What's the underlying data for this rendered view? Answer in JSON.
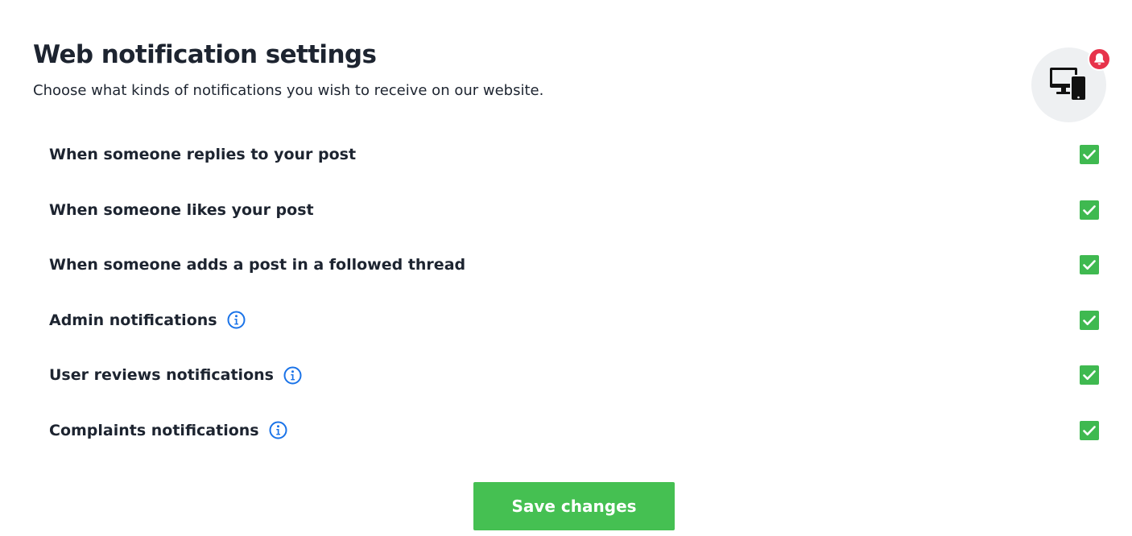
{
  "header": {
    "title": "Web notification settings",
    "subtitle": "Choose what kinds of notifications you wish to receive on our website."
  },
  "illustration": {
    "icon": "desktop-and-phone-icon",
    "badge_icon": "bell-icon",
    "badge_color": "#e7334b"
  },
  "settings": [
    {
      "label": "When someone replies to your post",
      "info": false,
      "checked": true
    },
    {
      "label": "When someone likes your post",
      "info": false,
      "checked": true
    },
    {
      "label": "When someone adds a post in a followed thread",
      "info": false,
      "checked": true
    },
    {
      "label": "Admin notifications",
      "info": true,
      "checked": true
    },
    {
      "label": "User reviews notifications",
      "info": true,
      "checked": true
    },
    {
      "label": "Complaints notifications",
      "info": true,
      "checked": true
    }
  ],
  "actions": {
    "save_label": "Save changes"
  },
  "colors": {
    "accent": "#45c052",
    "checkbox": "#3fb950",
    "info": "#1a73e8",
    "text": "#1d2430"
  }
}
